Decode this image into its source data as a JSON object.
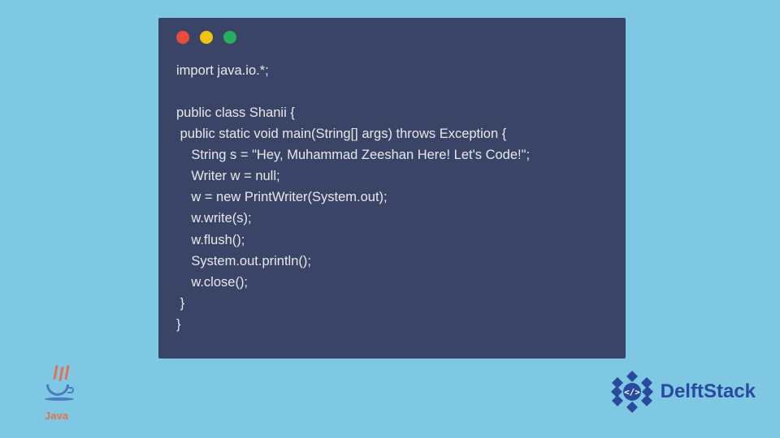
{
  "code": {
    "content": "import java.io.*;\n\npublic class Shanii {\n public static void main(String[] args) throws Exception {\n    String s = \"Hey, Muhammad Zeeshan Here! Let's Code!\";\n    Writer w = null;\n    w = new PrintWriter(System.out);\n    w.write(s);\n    w.flush();\n    System.out.println();\n    w.close();\n }\n}"
  },
  "logos": {
    "java_text": "Java",
    "delft_text": "DelftStack"
  },
  "colors": {
    "background": "#7ec8e3",
    "window_bg": "#3a4466",
    "code_text": "#e8e8e8",
    "red": "#e74c3c",
    "yellow": "#f1c40f",
    "green": "#27ae60",
    "delft_blue": "#2a4a9e",
    "java_orange": "#e76f51",
    "java_blue": "#4a7cbf"
  }
}
